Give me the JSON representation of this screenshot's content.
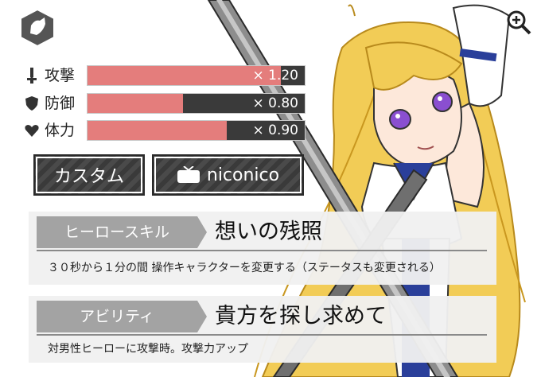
{
  "stats": [
    {
      "label": "攻撃",
      "value": "× 1.20",
      "fill": 0.89,
      "icon": "sword-icon"
    },
    {
      "label": "防御",
      "value": "× 0.80",
      "fill": 0.44,
      "icon": "shield-icon"
    },
    {
      "label": "体力",
      "value": "× 0.90",
      "fill": 0.64,
      "icon": "heart-icon"
    }
  ],
  "buttons": {
    "custom_label": "カスタム",
    "nico_label": "niconico"
  },
  "hero_skill": {
    "tag": "ヒーロースキル",
    "name": "想いの残照",
    "description": "３０秒から１分の間 操作キャラクターを変更する（ステータスも変更される）"
  },
  "ability": {
    "tag": "アビリティ",
    "name": "貴方を探し求めて",
    "description": "対男性ヒーローに攻撃時。攻撃力アップ"
  },
  "colors": {
    "bar_fill": "#e47d7c",
    "bar_bg": "#3a3a3a",
    "tag_bg": "#a3a3a3",
    "hair": "#f0c84a",
    "eyes": "#8a4fd0"
  }
}
